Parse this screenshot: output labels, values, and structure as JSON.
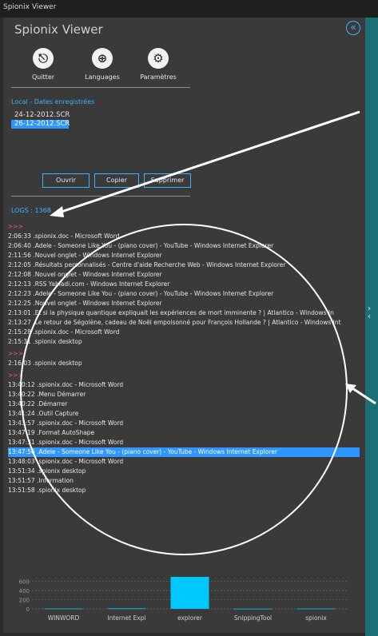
{
  "window": {
    "title": "Spionix Viewer"
  },
  "app": {
    "title": "Spionix Viewer",
    "collapse_icon": "double-chevron-left-icon"
  },
  "toolbar": {
    "quit_label": "Quitter",
    "languages_label": "Languages",
    "settings_label": "Paramètres"
  },
  "files": {
    "section_label": "Local - Dates enregistrées",
    "items": [
      "24-12-2012.SCR",
      "26-12-2012.SCR"
    ],
    "selected_index": 1
  },
  "actions": {
    "open": "Ouvrir",
    "copy": "Copier",
    "delete": "Supprimer"
  },
  "logs": {
    "label": "LOGS : 1368",
    "lines": [
      {
        "kind": "sep",
        "text": ">>>"
      },
      {
        "kind": "line",
        "time": "2:06:33",
        "text": ".spionix.doc - Microsoft Word"
      },
      {
        "kind": "line",
        "time": "2:06:40",
        "text": ".Adele - Someone Like You - (piano cover) - YouTube - Windows Internet Explorer"
      },
      {
        "kind": "line",
        "time": "2:11:56",
        "text": ".Nouvel onglet - Windows Internet Explorer"
      },
      {
        "kind": "line",
        "time": "2:12:05",
        "text": ".Résultats personnalisés - Centre d'aide Recherche Web - Windows Internet Explorer"
      },
      {
        "kind": "line",
        "time": "2:12:08",
        "text": ".Nouvel onglet - Windows Internet Explorer"
      },
      {
        "kind": "line",
        "time": "2:12:13",
        "text": ".RSS Yahiadi.com - Windows Internet Explorer"
      },
      {
        "kind": "line",
        "time": "2:12:23",
        "text": ".Adele - Someone Like You - (piano cover) - YouTube - Windows Internet Explorer"
      },
      {
        "kind": "line",
        "time": "2:12:25",
        "text": ".Nouvel onglet - Windows Internet Explorer"
      },
      {
        "kind": "line",
        "time": "2:13:01",
        "text": ".Et si la physique quantique expliquait les expériences de mort imminente ? | Atlantico - Windows In"
      },
      {
        "kind": "line",
        "time": "2:13:27",
        "text": ".Le retour de Ségolène, cadeau de Noël empoisonné pour François Hollande ? | Atlantico - Windows Int"
      },
      {
        "kind": "line",
        "time": "2:15:28",
        "text": ".spionix.doc - Microsoft Word"
      },
      {
        "kind": "line",
        "time": "2:15:31",
        "text": ".spionix desktop"
      },
      {
        "kind": "sep",
        "text": ">>>"
      },
      {
        "kind": "line",
        "time": "2:16:03",
        "text": ".spionix desktop"
      },
      {
        "kind": "sep",
        "text": ">>>"
      },
      {
        "kind": "line",
        "time": "13:40:12",
        "text": ".spionix.doc - Microsoft Word"
      },
      {
        "kind": "line",
        "time": "13:40:22",
        "text": ".Menu Démarrer"
      },
      {
        "kind": "line",
        "time": "13:40:22",
        "text": ".Démarrer"
      },
      {
        "kind": "line",
        "time": "13:41:24",
        "text": ".Outil Capture"
      },
      {
        "kind": "line",
        "time": "13:43:57",
        "text": ".spionix.doc - Microsoft Word"
      },
      {
        "kind": "line",
        "time": "13:47:19",
        "text": ".Format AutoShape"
      },
      {
        "kind": "line",
        "time": "13:47:31",
        "text": ".spionix.doc - Microsoft Word"
      },
      {
        "kind": "line",
        "time": "13:47:56",
        "text": ".Adele - Someone Like You - (piano cover) - YouTube - Windows Internet Explorer",
        "selected": true
      },
      {
        "kind": "line",
        "time": "13:48:03",
        "text": ".spionix.doc - Microsoft Word"
      },
      {
        "kind": "line",
        "time": "13:51:34",
        "text": ".spionix desktop"
      },
      {
        "kind": "line",
        "time": "13:51:57",
        "text": ".Information"
      },
      {
        "kind": "line",
        "time": "13:51:58",
        "text": ".spionix desktop"
      }
    ]
  },
  "chart_data": {
    "type": "bar",
    "categories": [
      "WINWORD",
      "Internet Expl",
      "explorer",
      "SnippingTool",
      "spionix"
    ],
    "values": [
      8,
      12,
      700,
      4,
      6
    ],
    "ylim": [
      0,
      700
    ],
    "yticks": [
      "600",
      "400",
      "200",
      "0"
    ],
    "grid": true,
    "colors": {
      "bar": "#00c8ff",
      "grid": "#6e6e6e"
    }
  },
  "colors": {
    "accent": "#3ab4ff",
    "selection": "#2f95ff",
    "separator": "#ff5b5b",
    "sidebar": "#1b6f75"
  }
}
